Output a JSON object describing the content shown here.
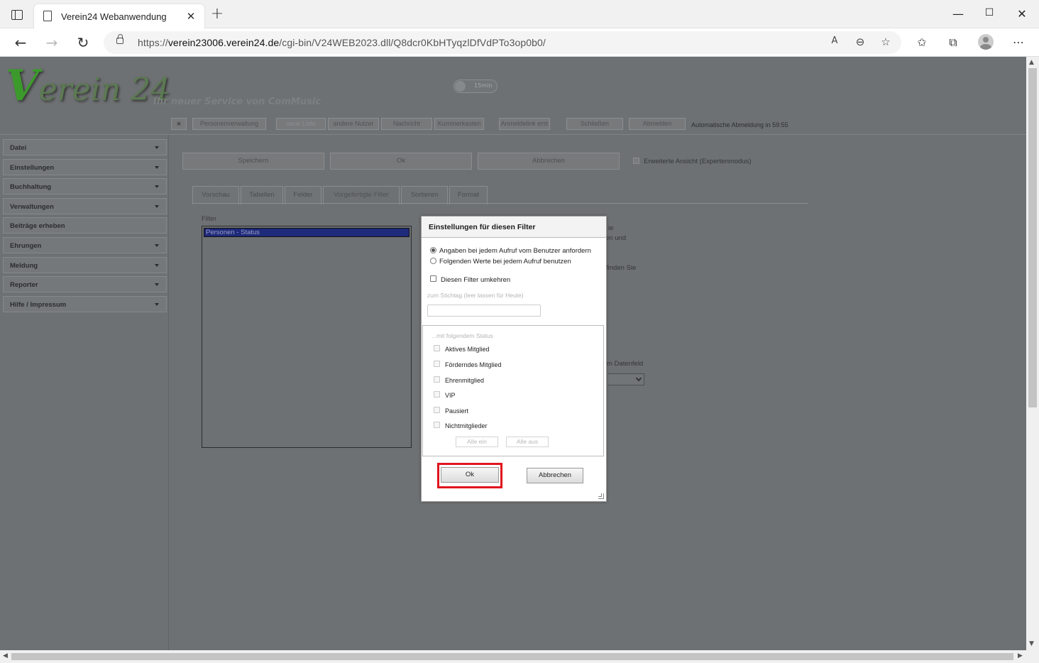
{
  "browser": {
    "tab_title": "Verein24 Webanwendung",
    "url_prefix": "https://",
    "url_host": "verein23006.verein24.de",
    "url_path": "/cgi-bin/V24WEB2023.dll/Q8dcr0KbHTyqzlDfVdPTo3op0b0/"
  },
  "header": {
    "logo_v": "V",
    "logo_rest": "erein 24",
    "slogan": "Ihr neuer Service von ComMusic",
    "timer": "15min",
    "auto_logout": "Automatische Abmeldung in 59:55"
  },
  "menubar": {
    "items": [
      "Personenverwaltung",
      "neue Liste",
      "andere Nutzer",
      "Nachricht",
      "Kummerkasten",
      "Anmeldelink erst",
      "Schließen",
      "Abmelden"
    ]
  },
  "sidebar": {
    "items": [
      {
        "label": "Datei",
        "has_caret": true
      },
      {
        "label": "Einstellungen",
        "has_caret": true
      },
      {
        "label": "Buchhaltung",
        "has_caret": true
      },
      {
        "label": "Verwaltungen",
        "has_caret": true
      },
      {
        "label": "Beiträge erheben",
        "has_caret": false
      },
      {
        "label": "Ehrungen",
        "has_caret": true
      },
      {
        "label": "Meldung",
        "has_caret": true
      },
      {
        "label": "Reporter",
        "has_caret": true
      },
      {
        "label": "Hilfe / Impressum",
        "has_caret": true
      }
    ]
  },
  "toolbar": {
    "save": "Speichern",
    "ok": "Ok",
    "cancel": "Abbrechen",
    "expert_mode": "Erweiterte Ansicht (Expertenmodus)"
  },
  "tabs": [
    "Vorschau",
    "Tabellen",
    "Felder",
    "Vorgefertigte Filter",
    "Sortieren",
    "Format"
  ],
  "active_tab": "Vorgefertigte Filter",
  "filter": {
    "label": "Filter",
    "items": [
      "Personen - Status"
    ]
  },
  "background_text": {
    "line1": "ie",
    "line2": "en und",
    "line3": "finden Sie",
    "line4": "m Datenfeld"
  },
  "dialog": {
    "title": "Einstellungen für diesen Filter",
    "radio_ask": "Angaben bei jedem Aufruf vom Benutzer anfordern",
    "radio_fixed": "Folgenden Werte bei jedem Aufruf benutzen",
    "invert": "Diesen Filter umkehren",
    "date_label": "zum Stichtag (leer lassen für Heute)",
    "date_value": "",
    "status_legend": "...mit folgendem Status",
    "status_options": [
      "Aktives Mitglied",
      "Förderndes Mitglied",
      "Ehrenmitglied",
      "VIP",
      "Pausiert",
      "Nichtmitglieder"
    ],
    "all_on": "Alle ein",
    "all_off": "Alle aus",
    "ok": "Ok",
    "cancel": "Abbrechen"
  },
  "colors": {
    "highlight": "#e0141e",
    "page_overlay": "#6e7173",
    "selection": "#1e2a7a"
  }
}
